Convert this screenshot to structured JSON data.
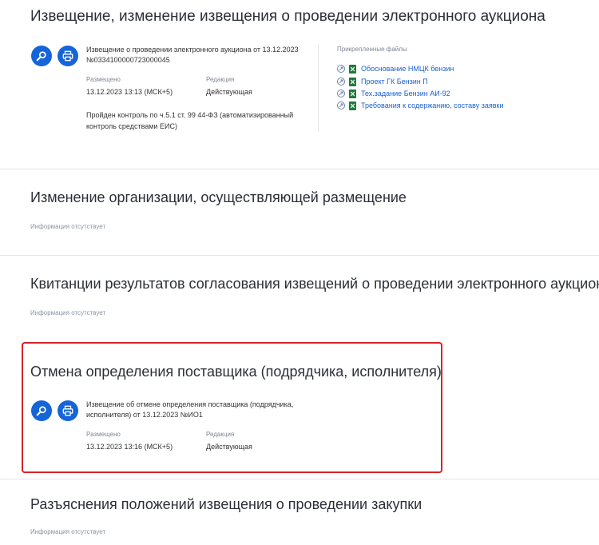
{
  "s1": {
    "title": "Извещение, изменение извещения о проведении электронного аукциона",
    "doc_title": "Извещение о проведении электронного аукциона от 13.12.2023 №0334100000723000045",
    "posted_label": "Размещено",
    "posted_value": "13.12.2023 13:13 (МСК+5)",
    "edition_label": "Редакция",
    "edition_value": "Действующая",
    "control_text": "Пройден контроль по ч.5.1 ст. 99 44-ФЗ (автоматизированный контроль средствами ЕИС)",
    "files_label": "Прикрепленные файлы",
    "files": [
      "Обоснование НМЦК бензин",
      "Проект ГК Бензин П",
      "Тех.задание Бензин АИ-92",
      "Требования к содержанию, составу заявки"
    ]
  },
  "s2": {
    "title": "Изменение организации, осуществляющей размещение",
    "noinfo": "Информация отсутствует"
  },
  "s3": {
    "title": "Квитанции результатов согласования извещений о проведении электронного аукциона",
    "noinfo": "Информация отсутствует"
  },
  "s4": {
    "title": "Отмена определения поставщика (подрядчика, исполнителя)",
    "doc_title": "Извещение об отмене определения поставщика (подрядчика, исполнителя) от 13.12.2023 №ИО1",
    "posted_label": "Размещено",
    "posted_value": "13.12.2023 13:16 (МСК+5)",
    "edition_label": "Редакция",
    "edition_value": "Действующая"
  },
  "s5": {
    "title": "Разъяснения положений извещения о проведении закупки",
    "noinfo": "Информация отсутствует"
  },
  "colors": {
    "accent": "#1565d8",
    "link": "#1a5fcc",
    "highlight": "#d8232a",
    "excel": "#1f7a3a"
  },
  "icons": [
    "search-icon",
    "print-icon",
    "open-icon",
    "excel-file-icon"
  ]
}
